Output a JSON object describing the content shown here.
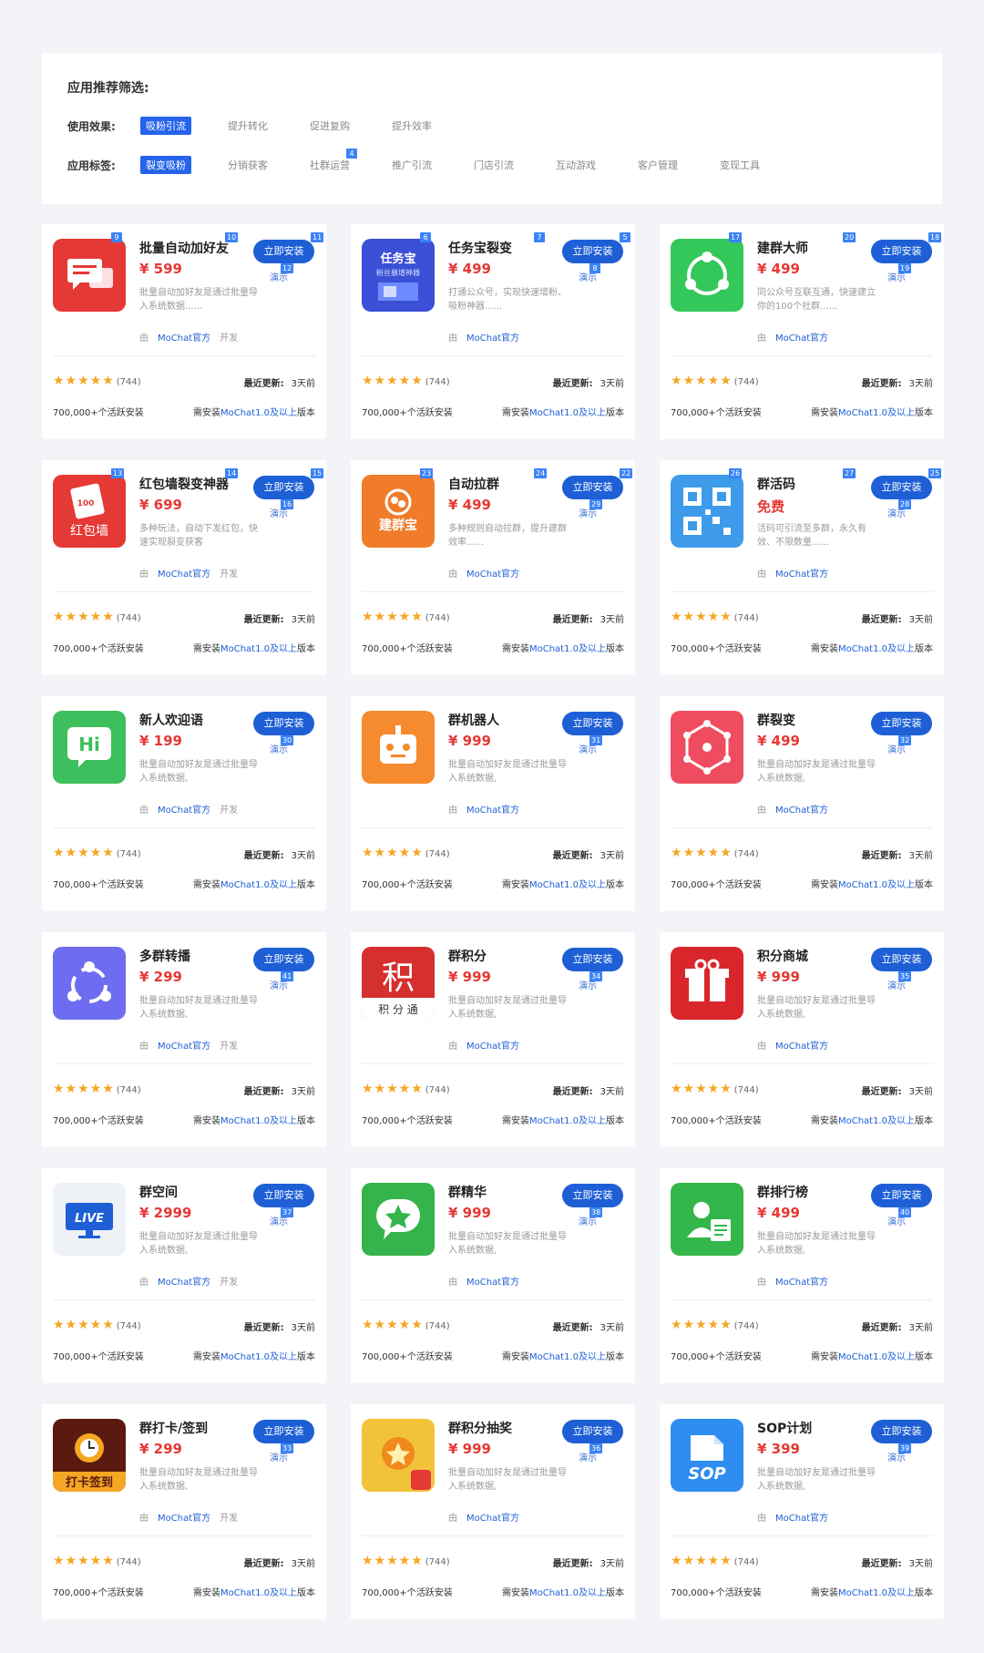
{
  "filter": {
    "title": "应用推荐筛选:",
    "effect_label": "使用效果:",
    "effect_tags": [
      {
        "label": "吸粉引流",
        "active": true,
        "badge": ""
      },
      {
        "label": "提升转化",
        "active": false,
        "badge": ""
      },
      {
        "label": "促进复购",
        "active": false,
        "badge": ""
      },
      {
        "label": "提升效率",
        "active": false,
        "badge": ""
      }
    ],
    "tag_label": "应用标签:",
    "tags": [
      {
        "label": "裂变吸粉",
        "active": true,
        "badge": ""
      },
      {
        "label": "分销获客",
        "active": false,
        "badge": ""
      },
      {
        "label": "社群运营",
        "active": false,
        "badge": "4"
      },
      {
        "label": "推广引流",
        "active": false,
        "badge": ""
      },
      {
        "label": "门店引流",
        "active": false,
        "badge": ""
      },
      {
        "label": "互动游戏",
        "active": false,
        "badge": ""
      },
      {
        "label": "客户管理",
        "active": false,
        "badge": ""
      },
      {
        "label": "变现工具",
        "active": false,
        "badge": ""
      }
    ]
  },
  "common": {
    "install": "立即安装",
    "demo": "演示",
    "by": "由",
    "developer": "MoChat官方",
    "dev_suffix": "开发",
    "stars": "★★★★★",
    "rating_count": "(744)",
    "update_label": "最近更新:",
    "update_value": "3天前",
    "active_installs": "700,000+个活跃安装",
    "require_prefix": "需安装",
    "require_version": "MoChat1.0及以上",
    "require_suffix": "版本"
  },
  "colors": {
    "accent": "#1e5fd6",
    "price": "#e53935",
    "star": "#f5a623",
    "badge": "#3b82f6"
  },
  "apps": [
    {
      "name": "批量自动加好友",
      "price": "¥ 599",
      "desc": "批量自动加好友是通过批量导入系统数据......",
      "show_dev_suffix": true,
      "icon": "chat-bubble-icon",
      "icon_color": "#e53935",
      "badges": [
        "9",
        "10",
        "11",
        "12"
      ]
    },
    {
      "name": "任务宝裂变",
      "price": "¥ 499",
      "desc": "打通公众号，实现快速增粉、吸粉神器......",
      "show_dev_suffix": false,
      "icon": "task-treasure-icon",
      "icon_color": "#3b50d6",
      "icon_text": "任务宝",
      "icon_subtext": "粉丝暴增神器",
      "badges": [
        "6",
        "7",
        "5",
        "8"
      ]
    },
    {
      "name": "建群大师",
      "price": "¥ 499",
      "desc": "同公众号互联互通，快速建立你的100个社群......",
      "show_dev_suffix": false,
      "icon": "group-share-icon",
      "icon_color": "#34c759",
      "badges": [
        "17",
        "20",
        "18",
        "19"
      ]
    },
    {
      "name": "红包墙裂变神器",
      "price": "¥ 699",
      "desc": "多种玩法，自动下发红包，快速实现裂变获客",
      "show_dev_suffix": true,
      "icon": "red-packet-wall-icon",
      "icon_color": "#e53935",
      "icon_text": "红包墙",
      "icon_subtext": "100",
      "badges": [
        "13",
        "14",
        "15",
        "16"
      ]
    },
    {
      "name": "自动拉群",
      "price": "¥ 499",
      "desc": "多种规则自动拉群，提升建群效率......",
      "show_dev_suffix": false,
      "icon": "jianqunbao-icon",
      "icon_color": "#f07c2a",
      "icon_text": "建群宝",
      "badges": [
        "23",
        "24",
        "22",
        "29"
      ]
    },
    {
      "name": "群活码",
      "price": "免费",
      "desc": "活码可引流至多群，永久有效、不限数量......",
      "show_dev_suffix": false,
      "icon": "qr-code-icon",
      "icon_color": "#3d9be9",
      "badges": [
        "26",
        "27",
        "25",
        "28"
      ]
    },
    {
      "name": "新人欢迎语",
      "price": "¥ 199",
      "desc": "批量自动加好友是通过批量导入系统数据,",
      "show_dev_suffix": true,
      "icon": "hi-chat-icon",
      "icon_color": "#3cbf5c",
      "icon_text": "Hi",
      "badges": [
        "",
        "",
        "",
        "30"
      ]
    },
    {
      "name": "群机器人",
      "price": "¥ 999",
      "desc": "批量自动加好友是通过批量导入系统数据,",
      "show_dev_suffix": false,
      "icon": "robot-icon",
      "icon_color": "#f58a2e",
      "badges": [
        "",
        "",
        "",
        "31"
      ]
    },
    {
      "name": "群裂变",
      "price": "¥ 499",
      "desc": "批量自动加好友是通过批量导入系统数据,",
      "show_dev_suffix": false,
      "icon": "network-cube-icon",
      "icon_color": "#ef4d5f",
      "badges": [
        "",
        "",
        "",
        "32"
      ]
    },
    {
      "name": "多群转播",
      "price": "¥ 299",
      "desc": "批量自动加好友是通过批量导入系统数据,",
      "show_dev_suffix": true,
      "icon": "broadcast-icon",
      "icon_color": "#6e6cf0",
      "badges": [
        "",
        "",
        "",
        "41"
      ]
    },
    {
      "name": "群积分",
      "price": "¥ 999",
      "desc": "批量自动加好友是通过批量导入系统数据,",
      "show_dev_suffix": false,
      "icon": "points-icon",
      "icon_color": "#d62f2f",
      "icon_text": "积",
      "icon_subtext": "积 分 通",
      "badges": [
        "",
        "",
        "",
        "34"
      ]
    },
    {
      "name": "积分商城",
      "price": "¥ 999",
      "desc": "批量自动加好友是通过批量导入系统数据,",
      "show_dev_suffix": false,
      "icon": "gift-icon",
      "icon_color": "#d9262b",
      "badges": [
        "",
        "",
        "",
        "35"
      ]
    },
    {
      "name": "群空间",
      "price": "¥ 2999",
      "desc": "批量自动加好友是通过批量导入系统数据,",
      "show_dev_suffix": true,
      "icon": "live-tv-icon",
      "icon_color": "#eef1f6",
      "icon_text": "LIVE",
      "badges": [
        "",
        "",
        "",
        "37"
      ]
    },
    {
      "name": "群精华",
      "price": "¥ 999",
      "desc": "批量自动加好友是通过批量导入系统数据,",
      "show_dev_suffix": false,
      "icon": "star-chat-icon",
      "icon_color": "#34b44a",
      "badges": [
        "",
        "",
        "",
        "38"
      ]
    },
    {
      "name": "群排行榜",
      "price": "¥ 499",
      "desc": "批量自动加好友是通过批量导入系统数据,",
      "show_dev_suffix": false,
      "icon": "user-card-icon",
      "icon_color": "#33b64a",
      "badges": [
        "",
        "",
        "",
        "40"
      ]
    },
    {
      "name": "群打卡/签到",
      "price": "¥ 299",
      "desc": "批量自动加好友是通过批量导入系统数据,",
      "show_dev_suffix": true,
      "icon": "checkin-icon",
      "icon_color": "#5a1a10",
      "icon_text": "打卡签到",
      "badges": [
        "",
        "",
        "",
        "33"
      ]
    },
    {
      "name": "群积分抽奖",
      "price": "¥ 999",
      "desc": "批量自动加好友是通过批量导入系统数据,",
      "show_dev_suffix": false,
      "icon": "lottery-icon",
      "icon_color": "#f2c33a",
      "badges": [
        "",
        "",
        "",
        "36"
      ]
    },
    {
      "name": "SOP计划",
      "price": "¥ 399",
      "desc": "批量自动加好友是通过批量导入系统数据,",
      "show_dev_suffix": false,
      "icon": "sop-icon",
      "icon_color": "#2f8cf0",
      "icon_text": "SOP",
      "badges": [
        "",
        "",
        "",
        "39"
      ]
    }
  ]
}
